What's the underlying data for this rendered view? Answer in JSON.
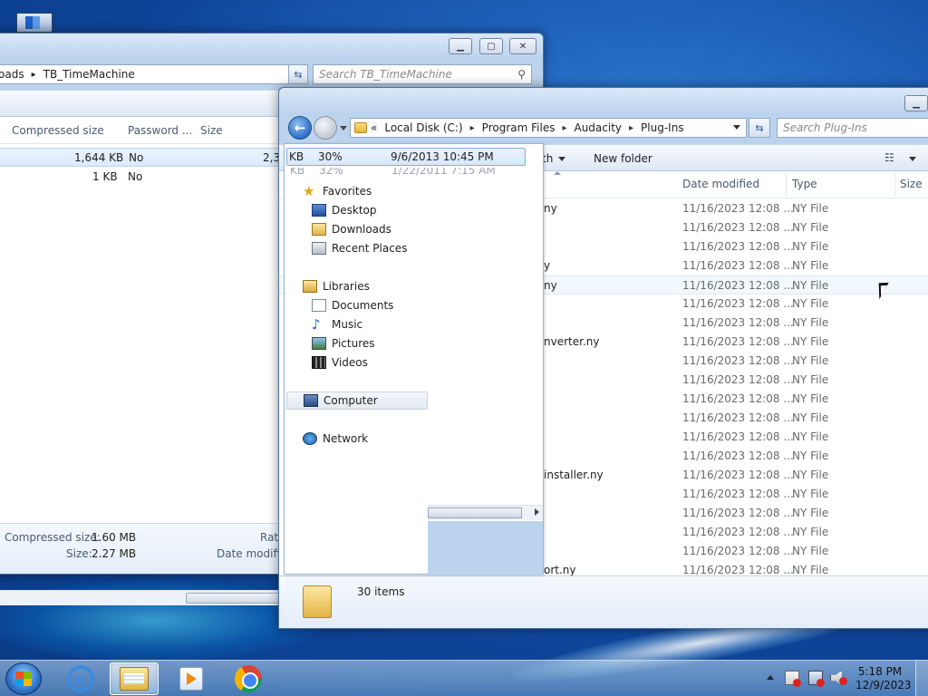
{
  "window_back": {
    "breadcrumb": [
      "oads",
      "TB_TimeMachine"
    ],
    "search_placeholder": "Search TB_TimeMachine",
    "columns": [
      "Compressed size",
      "Password ...",
      "Size"
    ],
    "rows": [
      {
        "compressed": "1,644 KB",
        "password": "No",
        "size": "2,3"
      },
      {
        "compressed": "1 KB",
        "password": "No",
        "size": ""
      }
    ],
    "details": {
      "compressed_label": "Compressed size:",
      "compressed_value": "1.60 MB",
      "size_label": "Size:",
      "size_value": "2.27 MB",
      "ratio_label": "Rati",
      "date_label": "Date modifie"
    }
  },
  "window_front": {
    "breadcrumb": [
      "Local Disk (C:)",
      "Program Files",
      "Audacity",
      "Plug-Ins"
    ],
    "breadcrumb_prefix": "«",
    "search_placeholder": "Search Plug-Ins",
    "toolbar": {
      "share_label": "th",
      "new_folder": "New folder"
    },
    "columns": [
      "Date modified",
      "Type",
      "Size"
    ],
    "files": [
      {
        "name": "ny",
        "date": "11/16/2023 12:08 ...",
        "type": "NY File"
      },
      {
        "name": "",
        "date": "11/16/2023 12:08 ...",
        "type": "NY File"
      },
      {
        "name": "",
        "date": "11/16/2023 12:08 ...",
        "type": "NY File"
      },
      {
        "name": "y",
        "date": "11/16/2023 12:08 ...",
        "type": "NY File"
      },
      {
        "name": "ny",
        "date": "11/16/2023 12:08 ...",
        "type": "NY File"
      },
      {
        "name": "",
        "date": "11/16/2023 12:08 ...",
        "type": "NY File"
      },
      {
        "name": "",
        "date": "11/16/2023 12:08 ...",
        "type": "NY File"
      },
      {
        "name": "nverter.ny",
        "date": "11/16/2023 12:08 ...",
        "type": "NY File"
      },
      {
        "name": "",
        "date": "11/16/2023 12:08 ...",
        "type": "NY File"
      },
      {
        "name": "",
        "date": "11/16/2023 12:08 ...",
        "type": "NY File"
      },
      {
        "name": "",
        "date": "11/16/2023 12:08 ...",
        "type": "NY File"
      },
      {
        "name": "",
        "date": "11/16/2023 12:08 ...",
        "type": "NY File"
      },
      {
        "name": "",
        "date": "11/16/2023 12:08 ...",
        "type": "NY File"
      },
      {
        "name": "",
        "date": "11/16/2023 12:08 ...",
        "type": "NY File"
      },
      {
        "name": "installer.ny",
        "date": "11/16/2023 12:08 ...",
        "type": "NY File"
      },
      {
        "name": "",
        "date": "11/16/2023 12:08 ...",
        "type": "NY File"
      },
      {
        "name": "",
        "date": "11/16/2023 12:08 ...",
        "type": "NY File"
      },
      {
        "name": "",
        "date": "11/16/2023 12:08 ...",
        "type": "NY File"
      },
      {
        "name": "",
        "date": "11/16/2023 12:08 ...",
        "type": "NY File"
      },
      {
        "name": "ort.ny",
        "date": "11/16/2023 12:08 ...",
        "type": "NY File"
      }
    ],
    "status": "30 items"
  },
  "nav_pane": {
    "top_row": {
      "size": "KB",
      "ratio": "30%",
      "date": "9/6/2013 10:45 PM"
    },
    "ghost_row": {
      "size": "KB",
      "ratio": "32%",
      "date": "1/22/2011 7:15 AM"
    },
    "favorites": "Favorites",
    "desktop": "Desktop",
    "downloads": "Downloads",
    "recent": "Recent Places",
    "libraries": "Libraries",
    "documents": "Documents",
    "music": "Music",
    "pictures": "Pictures",
    "videos": "Videos",
    "computer": "Computer",
    "network": "Network"
  },
  "taskbar": {
    "time": "5:18 PM",
    "date": "12/9/2023"
  }
}
